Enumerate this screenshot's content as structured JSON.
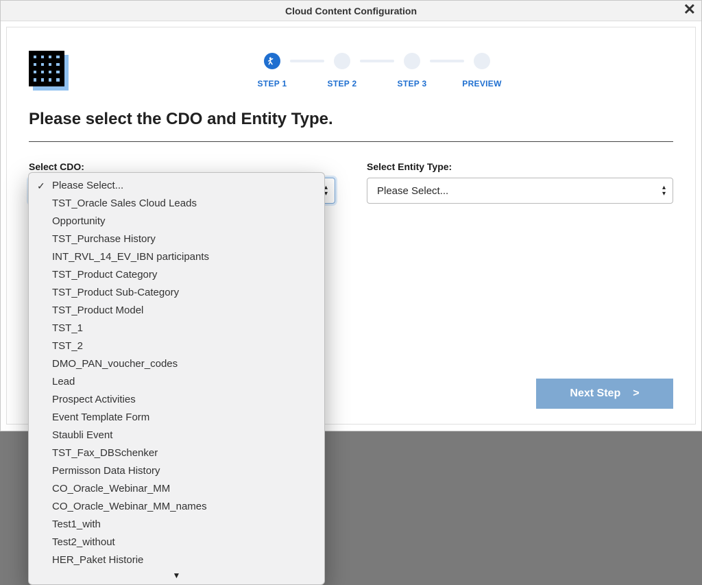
{
  "modal": {
    "title": "Cloud Content Configuration"
  },
  "steps": [
    {
      "label": "STEP 1",
      "active": true
    },
    {
      "label": "STEP 2",
      "active": false
    },
    {
      "label": "STEP 3",
      "active": false
    },
    {
      "label": "PREVIEW",
      "active": false
    }
  ],
  "heading": "Please select the CDO and Entity Type.",
  "cdo": {
    "label": "Select CDO:",
    "selected": "Please Select...",
    "options": [
      "Please Select...",
      "TST_Oracle Sales Cloud Leads",
      "Opportunity",
      "TST_Purchase History",
      "INT_RVL_14_EV_IBN participants",
      "TST_Product Category",
      "TST_Product Sub-Category",
      "TST_Product Model",
      "TST_1",
      "TST_2",
      "DMO_PAN_voucher_codes",
      "Lead",
      "Prospect Activities",
      "Event Template Form",
      "Staubli Event",
      "TST_Fax_DBSchenker",
      "Permisson Data History",
      "CO_Oracle_Webinar_MM",
      "CO_Oracle_Webinar_MM_names",
      "Test1_with",
      "Test2_without",
      "HER_Paket Historie"
    ]
  },
  "entity": {
    "label": "Select Entity Type:",
    "selected": "Please Select..."
  },
  "buttons": {
    "next": "Next Step",
    "next_chevron": ">"
  }
}
